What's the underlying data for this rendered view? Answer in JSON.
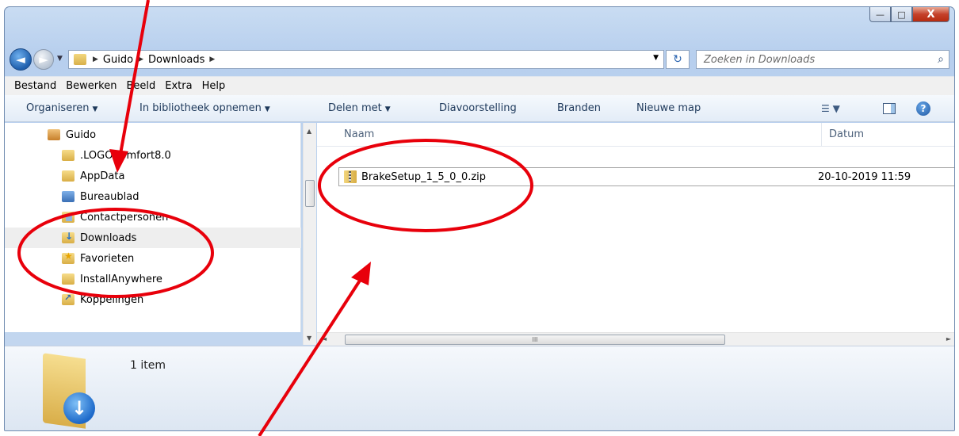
{
  "window": {
    "caption": {
      "minimize": "—",
      "maximize": "□",
      "close": "X"
    }
  },
  "address": {
    "crumbs": [
      "Guido",
      "Downloads"
    ],
    "search_placeholder": "Zoeken in Downloads"
  },
  "menu": [
    "Bestand",
    "Bewerken",
    "Beeld",
    "Extra",
    "Help"
  ],
  "commands": [
    {
      "label": "Organiseren",
      "dropdown": true
    },
    {
      "label": "In bibliotheek opnemen",
      "dropdown": true
    },
    {
      "label": "Delen met",
      "dropdown": true
    },
    {
      "label": "Diavoorstelling",
      "dropdown": false
    },
    {
      "label": "Branden",
      "dropdown": false
    },
    {
      "label": "Nieuwe map",
      "dropdown": false
    }
  ],
  "nav": {
    "items": [
      {
        "label": "Guido",
        "icon": "user-folder-icon",
        "selected": false
      },
      {
        "label": ".LOGOComfort8.0",
        "icon": "folder-icon",
        "selected": false
      },
      {
        "label": "AppData",
        "icon": "folder-icon",
        "selected": false
      },
      {
        "label": "Bureaublad",
        "icon": "desktop-folder-icon",
        "selected": false
      },
      {
        "label": "Contactpersonen",
        "icon": "contacts-folder-icon",
        "selected": false
      },
      {
        "label": "Downloads",
        "icon": "downloads-folder-icon",
        "selected": true
      },
      {
        "label": "Favorieten",
        "icon": "favorites-folder-icon",
        "selected": false
      },
      {
        "label": "InstallAnywhere",
        "icon": "folder-icon",
        "selected": false
      },
      {
        "label": "Koppelingen",
        "icon": "links-folder-icon",
        "selected": false
      }
    ]
  },
  "content": {
    "columns": {
      "name": "Naam",
      "date": "Datum"
    },
    "files": [
      {
        "name": "BrakeSetup_1_5_0_0.zip",
        "date": "20-10-2019 11:59",
        "icon": "zip-icon"
      }
    ],
    "hscroll_grip": "III"
  },
  "details": {
    "count": "1 item"
  },
  "annotation": {
    "color": "#e8000b"
  }
}
